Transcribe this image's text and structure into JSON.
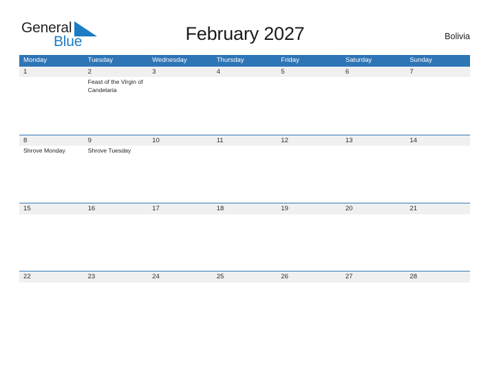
{
  "brand": {
    "name_part1": "General",
    "name_part2": "Blue",
    "flag_icon": "blue-triangle-flag-icon",
    "color_dark": "#231f20",
    "color_blue": "#1b7cc4"
  },
  "header": {
    "title": "February 2027",
    "month": "February",
    "year": "2027",
    "region": "Bolivia"
  },
  "colors": {
    "header_blue": "#2e75b6",
    "row_separator_blue": "#2e75b6",
    "date_band_gray": "#f0f0f0",
    "page_background": "#ffffff",
    "text": "#1f1f1f"
  },
  "calendar": {
    "weekday_headers": [
      "Monday",
      "Tuesday",
      "Wednesday",
      "Thursday",
      "Friday",
      "Saturday",
      "Sunday"
    ],
    "weeks": [
      {
        "days": [
          {
            "date": "1",
            "events": []
          },
          {
            "date": "2",
            "events": [
              "Feast of the Virgin of Candelaria"
            ]
          },
          {
            "date": "3",
            "events": []
          },
          {
            "date": "4",
            "events": []
          },
          {
            "date": "5",
            "events": []
          },
          {
            "date": "6",
            "events": []
          },
          {
            "date": "7",
            "events": []
          }
        ]
      },
      {
        "days": [
          {
            "date": "8",
            "events": [
              "Shrove Monday"
            ]
          },
          {
            "date": "9",
            "events": [
              "Shrove Tuesday"
            ]
          },
          {
            "date": "10",
            "events": []
          },
          {
            "date": "11",
            "events": []
          },
          {
            "date": "12",
            "events": []
          },
          {
            "date": "13",
            "events": []
          },
          {
            "date": "14",
            "events": []
          }
        ]
      },
      {
        "days": [
          {
            "date": "15",
            "events": []
          },
          {
            "date": "16",
            "events": []
          },
          {
            "date": "17",
            "events": []
          },
          {
            "date": "18",
            "events": []
          },
          {
            "date": "19",
            "events": []
          },
          {
            "date": "20",
            "events": []
          },
          {
            "date": "21",
            "events": []
          }
        ]
      },
      {
        "days": [
          {
            "date": "22",
            "events": []
          },
          {
            "date": "23",
            "events": []
          },
          {
            "date": "24",
            "events": []
          },
          {
            "date": "25",
            "events": []
          },
          {
            "date": "26",
            "events": []
          },
          {
            "date": "27",
            "events": []
          },
          {
            "date": "28",
            "events": []
          }
        ]
      }
    ]
  }
}
